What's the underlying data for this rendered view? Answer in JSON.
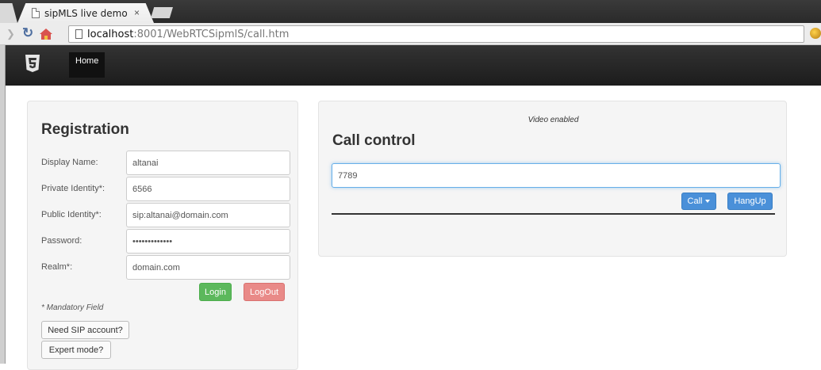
{
  "browser": {
    "tab_title": "sipMLS live demo",
    "tab_close": "×",
    "url_host": "localhost",
    "url_path": ":8001/WebRTCSipmlS/call.htm"
  },
  "navbar": {
    "home_label": "Home"
  },
  "registration": {
    "title": "Registration",
    "fields": [
      {
        "label": "Display Name:",
        "value": "altanai"
      },
      {
        "label": "Private Identity*:",
        "value": "6566"
      },
      {
        "label": "Public Identity*:",
        "value": "sip:altanai@domain.com"
      },
      {
        "label": "Password:",
        "value": "•••••••••••••"
      },
      {
        "label": "Realm*:",
        "value": "domain.com"
      }
    ],
    "login_label": "Login",
    "logout_label": "LogOut",
    "mandatory_note": "* Mandatory Field",
    "need_sip_label": "Need SIP account?",
    "expert_mode_label": "Expert mode?"
  },
  "call_control": {
    "video_status": "Video enabled",
    "title": "Call control",
    "number_value": "7789",
    "call_label": "Call",
    "hangup_label": "HangUp"
  },
  "colors": {
    "login": "#5cb85c",
    "logout": "#e98a88",
    "primary": "#4a90d9"
  }
}
